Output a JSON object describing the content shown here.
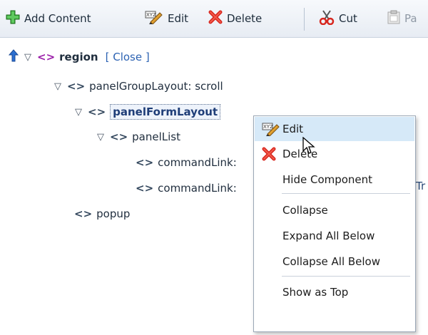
{
  "toolbar": {
    "add_content": "Add Content",
    "edit": "Edit",
    "delete": "Delete",
    "cut": "Cut",
    "paste": "Pa"
  },
  "tree": {
    "region": {
      "label": "region",
      "close_open": "[",
      "close_text": "Close",
      "close_close": "]"
    },
    "panelGroupLayout": "panelGroupLayout: scroll",
    "panelFormLayout": "panelFormLayout",
    "panelList": "panelList",
    "commandLink1": "commandLink:",
    "commandLink2": "commandLink:",
    "popup": "popup",
    "clipped_right": "Tr"
  },
  "context_menu": {
    "items": [
      {
        "label": "Edit",
        "icon": "edit-icon",
        "hovered": true
      },
      {
        "label": "Delete",
        "icon": "delete-icon",
        "hovered": false
      },
      {
        "label": "Hide Component",
        "icon": "",
        "hovered": false
      },
      {
        "label": "Collapse",
        "icon": "",
        "hovered": false
      },
      {
        "label": "Expand All Below",
        "icon": "",
        "hovered": false
      },
      {
        "label": "Collapse All Below",
        "icon": "",
        "hovered": false
      },
      {
        "label": "Show as Top",
        "icon": "",
        "hovered": false
      }
    ]
  },
  "colors": {
    "toolbar_bg": "#e7ecf3",
    "menu_hover": "#d6e9f8",
    "region_icon": "#9a1da8",
    "selected_text": "#1f3e78",
    "link": "#2d63b3"
  }
}
